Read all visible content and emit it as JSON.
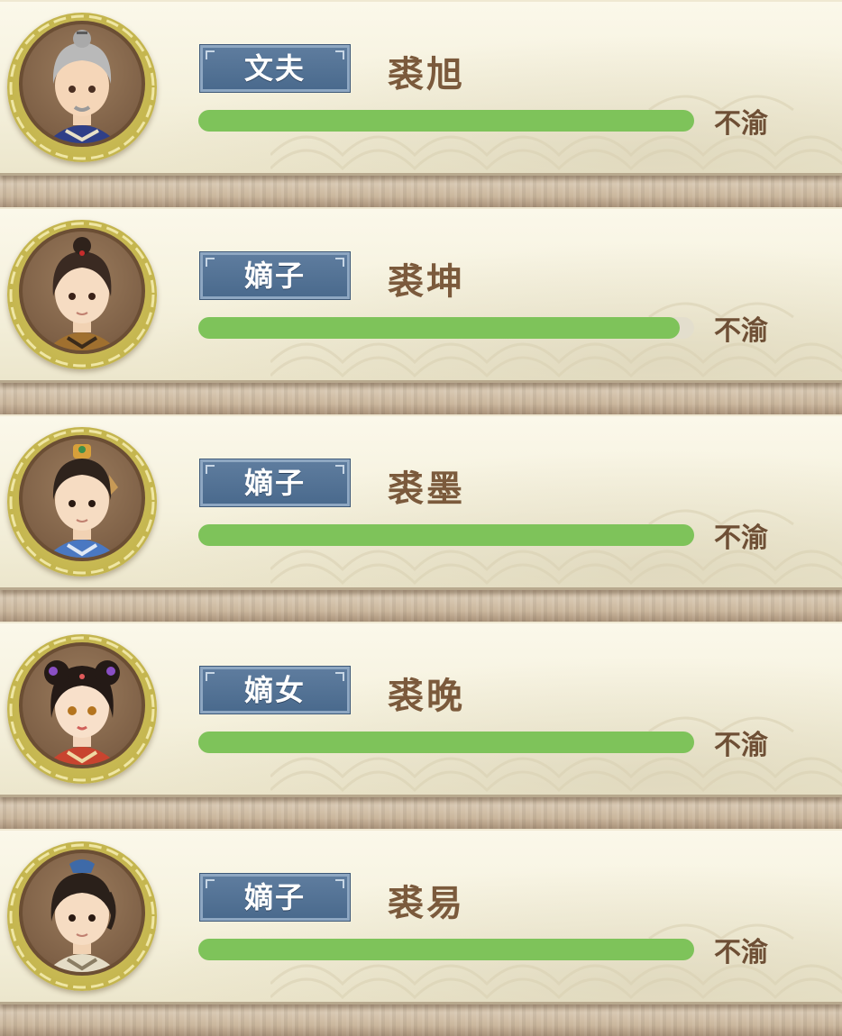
{
  "members": [
    {
      "role": "文夫",
      "name": "裘旭",
      "mood_label": "不渝",
      "bond_fraction": 1.0,
      "portrait_icon": "elder-man-portrait"
    },
    {
      "role": "嫡子",
      "name": "裘坤",
      "mood_label": "不渝",
      "bond_fraction": 0.97,
      "portrait_icon": "young-man-portrait"
    },
    {
      "role": "嫡子",
      "name": "裘墨",
      "mood_label": "不渝",
      "bond_fraction": 1.0,
      "portrait_icon": "young-man-topknot-portrait"
    },
    {
      "role": "嫡女",
      "name": "裘晚",
      "mood_label": "不渝",
      "bond_fraction": 1.0,
      "portrait_icon": "young-woman-portrait"
    },
    {
      "role": "嫡子",
      "name": "裘易",
      "mood_label": "不渝",
      "bond_fraction": 1.0,
      "portrait_icon": "young-man-crown-portrait"
    }
  ],
  "colors": {
    "badge": "#4a6a8d",
    "bar_fill": "#7ec35a",
    "name_text": "#7b5a3c"
  }
}
